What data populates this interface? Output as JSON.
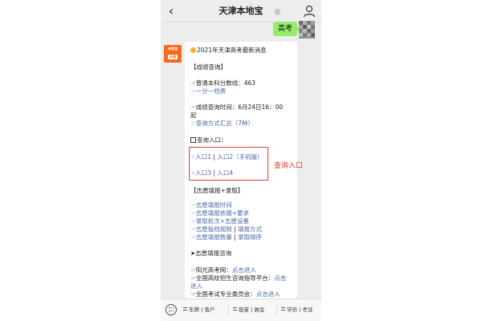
{
  "navbar": {
    "back_icon": "back-chevron-icon",
    "title": "天津本地宝",
    "user_icon": "user-profile-icon"
  },
  "chat": {
    "user_message": "高考"
  },
  "bot_avatar": {
    "text": "本地宝",
    "subtext": "天津"
  },
  "article": {
    "headline": "2021年天津高考最新消息",
    "section_score": "【成绩查询】",
    "score_line_prefix": "☞普通本科分数线：",
    "score_line_value": "463",
    "score_table_link": "☞一分一档表",
    "query_time_line1": "☞成绩查询时间：6月24日16：00",
    "query_time_line2": "起",
    "query_methods_link": "☞查询方式汇总（7种）",
    "query_entry_label": "查询入口：",
    "entries_row1": {
      "arrow": "☞",
      "entry1": "入口1",
      "sep": " | ",
      "entry2": "入口2（手机版）"
    },
    "entries_row2": {
      "arrow": "☞",
      "entry3": "入口3",
      "sep": " | ",
      "entry4": "入口4"
    },
    "section_volunteer": "【志愿填报+录取】",
    "volunteer_links": {
      "time": "☞志愿填报时间",
      "basis": "☞志愿填报依据+要求",
      "batches": "☞录取批次+志愿设置",
      "rules": "☞志愿投档规则",
      "method": "填报方式",
      "quantity": "☞志愿填报数量",
      "order": "录取顺序"
    },
    "section_consult": "➤志愿填报咨询",
    "consult_sunshine_prefix": "☞阳光高考网：",
    "consult_sunshine_link": "点击进入",
    "consult_platform_prefix": "☞全国高校招生咨询指导平台：",
    "consult_platform_link_a": "点击",
    "consult_platform_link_b": "进入",
    "consult_exam_prefix": "☞全国考试专业委员会：",
    "consult_exam_link": "点击进入"
  },
  "annotation": {
    "text": "查询入口",
    "color": "#e6372e"
  },
  "bottom_menu": {
    "keyboard_icon": "keyboard-toggle-icon",
    "menu_icon": "menu-lines-icon",
    "item1": "车牌 | 落户",
    "item2": "疫苗 | 展会",
    "item3": "学历 | 考证"
  },
  "colors": {
    "link": "#4a68a8",
    "user_bubble": "#95ec69",
    "bot_avatar": "#f26b1f",
    "chat_background": "#ededed"
  }
}
